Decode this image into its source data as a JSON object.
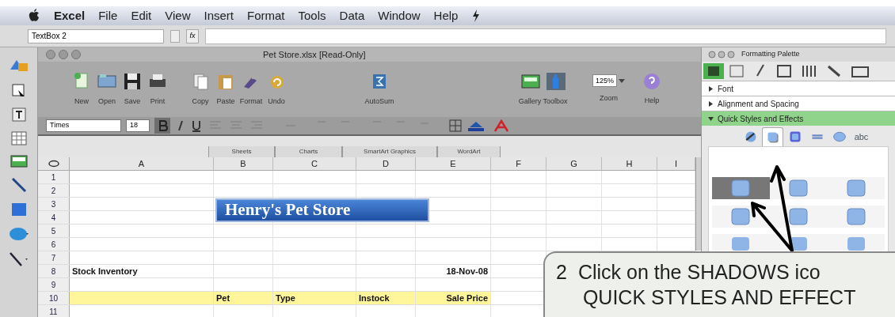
{
  "menu_bar": {
    "items": [
      "Excel",
      "File",
      "Edit",
      "View",
      "Insert",
      "Format",
      "Tools",
      "Data",
      "Window",
      "Help"
    ]
  },
  "formula_bar": {
    "name_box": "TextBox 2",
    "fx": "fx"
  },
  "window": {
    "title": "Pet Store.xlsx  [Read-Only]"
  },
  "toolbar": {
    "groups": [
      [
        {
          "label": "New",
          "kind": "new"
        },
        {
          "label": "Open",
          "kind": "open"
        },
        {
          "label": "Save",
          "kind": "save"
        },
        {
          "label": "Print",
          "kind": "print"
        }
      ],
      [
        {
          "label": "Copy",
          "kind": "copy"
        },
        {
          "label": "Paste",
          "kind": "paste"
        },
        {
          "label": "Format",
          "kind": "format"
        },
        {
          "label": "Undo",
          "kind": "undo"
        }
      ],
      [
        {
          "label": "AutoSum",
          "kind": "sum"
        }
      ],
      [
        {
          "label": "Gallery",
          "kind": "gallery"
        },
        {
          "label": "Toolbox",
          "kind": "toolbox"
        }
      ]
    ],
    "zoom": "125%",
    "zoom_label": "Zoom",
    "help": "Help"
  },
  "format_bar": {
    "font": "Times",
    "size": "18",
    "bold": true
  },
  "ribbon_tabs": [
    "Sheets",
    "Charts",
    "SmartArt Graphics",
    "WordArt"
  ],
  "sheet": {
    "columns": [
      "A",
      "B",
      "C",
      "D",
      "E",
      "F",
      "G",
      "H",
      "I"
    ],
    "rows": [
      {
        "number": "1",
        "highlighted": false
      },
      {
        "number": "2",
        "highlighted": false
      },
      {
        "number": "3",
        "highlighted": false
      },
      {
        "number": "4",
        "highlighted": false
      },
      {
        "number": "5",
        "highlighted": false
      },
      {
        "number": "6",
        "highlighted": false
      },
      {
        "number": "7",
        "highlighted": false
      },
      {
        "number": "8",
        "highlighted": false,
        "cells": {
          "column_1": "Stock Inventory",
          "column_5": "18-Nov-08"
        }
      },
      {
        "number": "9",
        "highlighted": false
      },
      {
        "number": "10",
        "highlighted": true,
        "cells": {
          "column_2": "Pet",
          "column_3": "Type",
          "column_4": "Instock",
          "column_5": "Sale Price"
        }
      },
      {
        "number": "11",
        "highlighted": false
      }
    ],
    "text_box": "Henry's Pet Store"
  },
  "palette": {
    "title": "Formatting Palette",
    "sections": [
      {
        "label": "Font",
        "expanded": false
      },
      {
        "label": "Alignment and Spacing",
        "expanded": false
      },
      {
        "label": "Quick Styles and Effects",
        "expanded": true
      }
    ],
    "style_tabs": [
      {
        "kind": "styles",
        "selected": false
      },
      {
        "kind": "shadow",
        "selected": true
      },
      {
        "kind": "glow",
        "selected": false
      },
      {
        "kind": "reflection",
        "selected": false
      },
      {
        "kind": "sphere",
        "selected": false
      },
      {
        "kind": "text",
        "label": "abc",
        "selected": false
      }
    ],
    "presets": [
      {
        "selected": true
      },
      {
        "selected": false
      },
      {
        "selected": false
      },
      {
        "selected": false
      },
      {
        "selected": false
      },
      {
        "selected": false
      },
      {
        "selected": false
      },
      {
        "selected": false
      },
      {
        "selected": false
      }
    ]
  },
  "callout": {
    "number": "2",
    "lines": [
      "Click on the SHADOWS ico",
      "QUICK STYLES AND EFFECT"
    ]
  }
}
